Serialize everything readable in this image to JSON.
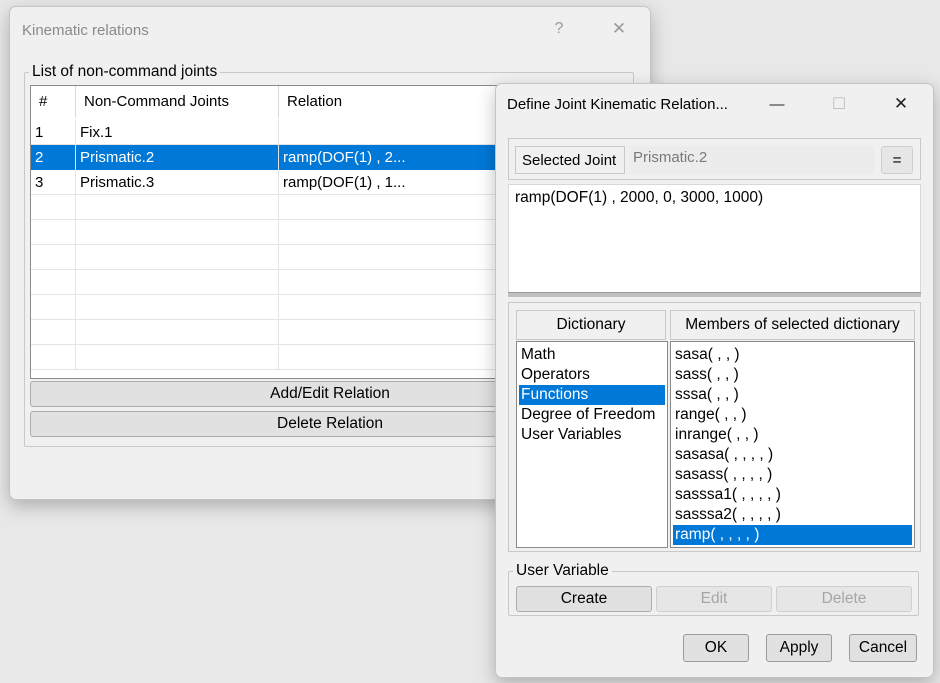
{
  "main_window": {
    "title": "Kinematic relations",
    "help_glyph": "?",
    "close_glyph": "✕",
    "group_label": "List of non-command joints",
    "columns": [
      "#",
      "Non-Command Joints",
      "Relation"
    ],
    "rows": [
      {
        "num": "1",
        "joint": "Fix.1",
        "relation": ""
      },
      {
        "num": "2",
        "joint": "Prismatic.2",
        "relation": "ramp(DOF(1) , 2..."
      },
      {
        "num": "3",
        "joint": "Prismatic.3",
        "relation": "ramp(DOF(1) , 1..."
      }
    ],
    "selected_row_index": 1,
    "add_edit_label": "Add/Edit Relation",
    "delete_label": "Delete Relation"
  },
  "dialog": {
    "title": "Define Joint Kinematic Relation...",
    "minimize_glyph": "—",
    "maximize_glyph": "☐",
    "close_glyph": "✕",
    "selected_joint_label": "Selected Joint",
    "selected_joint_value": "Prismatic.2",
    "equals_label": "=",
    "expression": "ramp(DOF(1) , 2000, 0, 3000, 1000)",
    "dictionary_header": "Dictionary",
    "members_header": "Members of selected dictionary",
    "dictionary_items": [
      "Math",
      "Operators",
      "Functions",
      "Degree of Freedom",
      "User Variables"
    ],
    "dictionary_selected_index": 2,
    "member_items": [
      "sasa( , , )",
      "sass( , , )",
      "sssa( , , )",
      "range( , , )",
      "inrange( , , )",
      "sasasa( , , , , )",
      "sasass( , , , , )",
      "sasssa1( , , , , )",
      "sasssa2( , , , , )",
      "ramp( , , , , )"
    ],
    "member_selected_index": 9,
    "user_variable_group": "User Variable",
    "create_label": "Create",
    "edit_label": "Edit",
    "delete_label": "Delete",
    "ok_label": "OK",
    "apply_label": "Apply",
    "cancel_label": "Cancel"
  }
}
